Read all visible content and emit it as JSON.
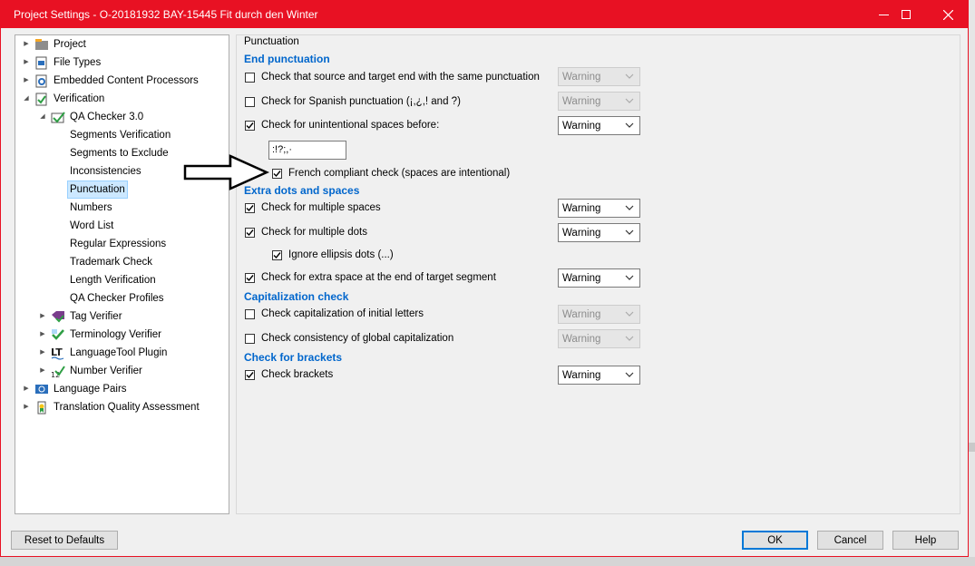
{
  "window": {
    "title": "Project Settings - O-20181932 BAY-15445 Fit durch den Winter"
  },
  "tree": {
    "items": [
      {
        "label": "Project",
        "icon": "project-icon"
      },
      {
        "label": "File Types",
        "icon": "file-types-icon"
      },
      {
        "label": "Embedded Content Processors",
        "icon": "embedded-icon"
      },
      {
        "label": "Verification",
        "icon": "verification-icon"
      },
      {
        "label": "QA Checker 3.0",
        "icon": "qa-checker-icon"
      },
      {
        "label": "Segments Verification"
      },
      {
        "label": "Segments to Exclude"
      },
      {
        "label": "Inconsistencies"
      },
      {
        "label": "Punctuation"
      },
      {
        "label": "Numbers"
      },
      {
        "label": "Word List"
      },
      {
        "label": "Regular Expressions"
      },
      {
        "label": "Trademark Check"
      },
      {
        "label": "Length Verification"
      },
      {
        "label": "QA Checker Profiles"
      },
      {
        "label": "Tag Verifier",
        "icon": "tag-verifier-icon"
      },
      {
        "label": "Terminology Verifier",
        "icon": "terminology-icon"
      },
      {
        "label": "LanguageTool Plugin",
        "icon": "languagetool-icon"
      },
      {
        "label": "Number Verifier",
        "icon": "number-verifier-icon"
      },
      {
        "label": "Language Pairs",
        "icon": "language-pairs-icon"
      },
      {
        "label": "Translation Quality Assessment",
        "icon": "tqa-icon"
      }
    ]
  },
  "panel": {
    "group_title": "Punctuation",
    "sections": {
      "end": "End punctuation",
      "dots": "Extra dots and spaces",
      "caps": "Capitalization check",
      "brackets": "Check for brackets"
    },
    "options": {
      "same_punct": {
        "label": "Check that source and target end with the same punctuation",
        "checked": false,
        "severity": "Warning",
        "enabled": false
      },
      "spanish": {
        "label": "Check for Spanish punctuation (¡,¿,! and ?)",
        "checked": false,
        "severity": "Warning",
        "enabled": false
      },
      "spaces_before": {
        "label": "Check for unintentional spaces before:",
        "checked": true,
        "severity": "Warning",
        "enabled": true
      },
      "spaces_chars": ":!?;,·",
      "french": {
        "label": "French compliant check (spaces are intentional)",
        "checked": true
      },
      "multi_spaces": {
        "label": "Check for multiple spaces",
        "checked": true,
        "severity": "Warning",
        "enabled": true
      },
      "multi_dots": {
        "label": "Check for multiple dots",
        "checked": true,
        "severity": "Warning",
        "enabled": true
      },
      "ellipsis": {
        "label": "Ignore ellipsis dots (...)",
        "checked": true
      },
      "extra_space_end": {
        "label": "Check for extra space at the end of target segment",
        "checked": true,
        "severity": "Warning",
        "enabled": true
      },
      "cap_initial": {
        "label": "Check capitalization of initial letters",
        "checked": false,
        "severity": "Warning",
        "enabled": false
      },
      "cap_global": {
        "label": "Check consistency of global capitalization",
        "checked": false,
        "severity": "Warning",
        "enabled": false
      },
      "brackets": {
        "label": "Check brackets",
        "checked": true,
        "severity": "Warning",
        "enabled": true
      }
    }
  },
  "buttons": {
    "reset": "Reset to Defaults",
    "ok": "OK",
    "cancel": "Cancel",
    "help": "Help"
  },
  "colors": {
    "accent": "#e81123",
    "section": "#0066cc",
    "selection": "#cce8ff"
  }
}
